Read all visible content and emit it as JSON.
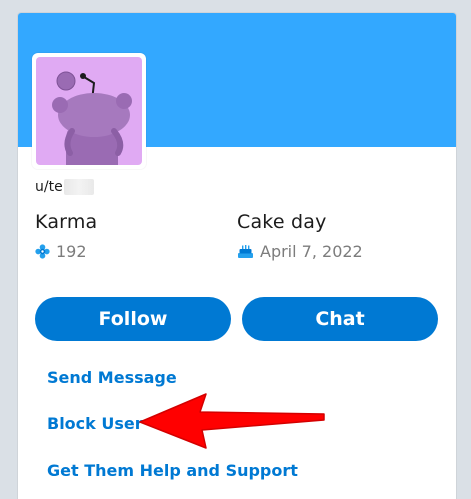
{
  "profile": {
    "username_visible": "u/te"
  },
  "stats": {
    "karma_label": "Karma",
    "karma_value": "192",
    "cakeday_label": "Cake day",
    "cakeday_value": "April 7, 2022"
  },
  "actions": {
    "follow_label": "Follow",
    "chat_label": "Chat"
  },
  "links": {
    "send_message": "Send Message",
    "block_user": "Block User",
    "get_help": "Get Them Help and Support"
  },
  "colors": {
    "banner": "#33a8ff",
    "avatar_bg": "#e0aaf3",
    "primary": "#0079d3",
    "annotation_arrow": "#ff0000"
  },
  "icons": {
    "karma": "karma-flower-icon",
    "cakeday": "cake-icon",
    "avatar": "snoo-avatar"
  }
}
